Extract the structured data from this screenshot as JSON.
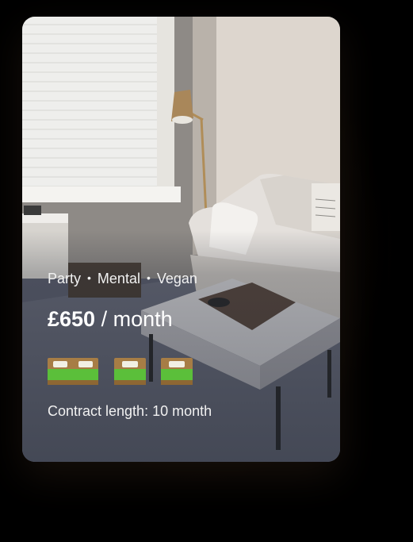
{
  "listing": {
    "tags": [
      "Party",
      "Mental",
      "Vegan"
    ],
    "tag_separator": "•",
    "price": "£650",
    "price_period": "/ month",
    "bed_icons": [
      "double-bed-icon",
      "single-bed-icon",
      "single-bed-icon"
    ],
    "contract_text": "Contract length: 10 month"
  },
  "colors": {
    "bed_green": "#5bbf3a",
    "bed_wood": "#a77d45",
    "pillow": "#f2f0e4",
    "text": "#ffffff"
  }
}
